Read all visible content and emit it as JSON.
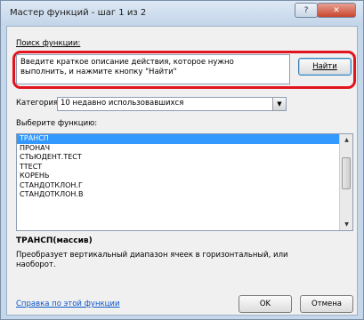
{
  "window": {
    "title": "Мастер функций - шаг 1 из 2",
    "help_icon": "?",
    "close_icon": "✕"
  },
  "search": {
    "label": "Поиск функции:",
    "value_line1": "Введите краткое описание действия, которое нужно",
    "value_line2": "выполнить, и нажмите кнопку \"Найти\"",
    "button": "Найти"
  },
  "category": {
    "label": "Категория:",
    "selected": "10 недавно использовавшихся"
  },
  "function_list": {
    "label": "Выберите функцию:",
    "items": [
      "ТРАНСП",
      "ПРОНАЧ",
      "СТЬЮДЕНТ.ТЕСТ",
      "TTECT",
      "КОРЕНЬ",
      "СТАНДОТКЛОН.Г",
      "СТАНДОТКЛОН.В"
    ],
    "selected_index": 0
  },
  "details": {
    "signature": "ТРАНСП(массив)",
    "description_line1": "Преобразует вертикальный диапазон ячеек в горизонтальный, или",
    "description_line2": "наоборот."
  },
  "footer": {
    "help_link": "Справка по этой функции",
    "ok": "OK",
    "cancel": "Отмена"
  },
  "colors": {
    "highlight": "#e2141d",
    "selection": "#3399ff",
    "link": "#0b57c9"
  }
}
